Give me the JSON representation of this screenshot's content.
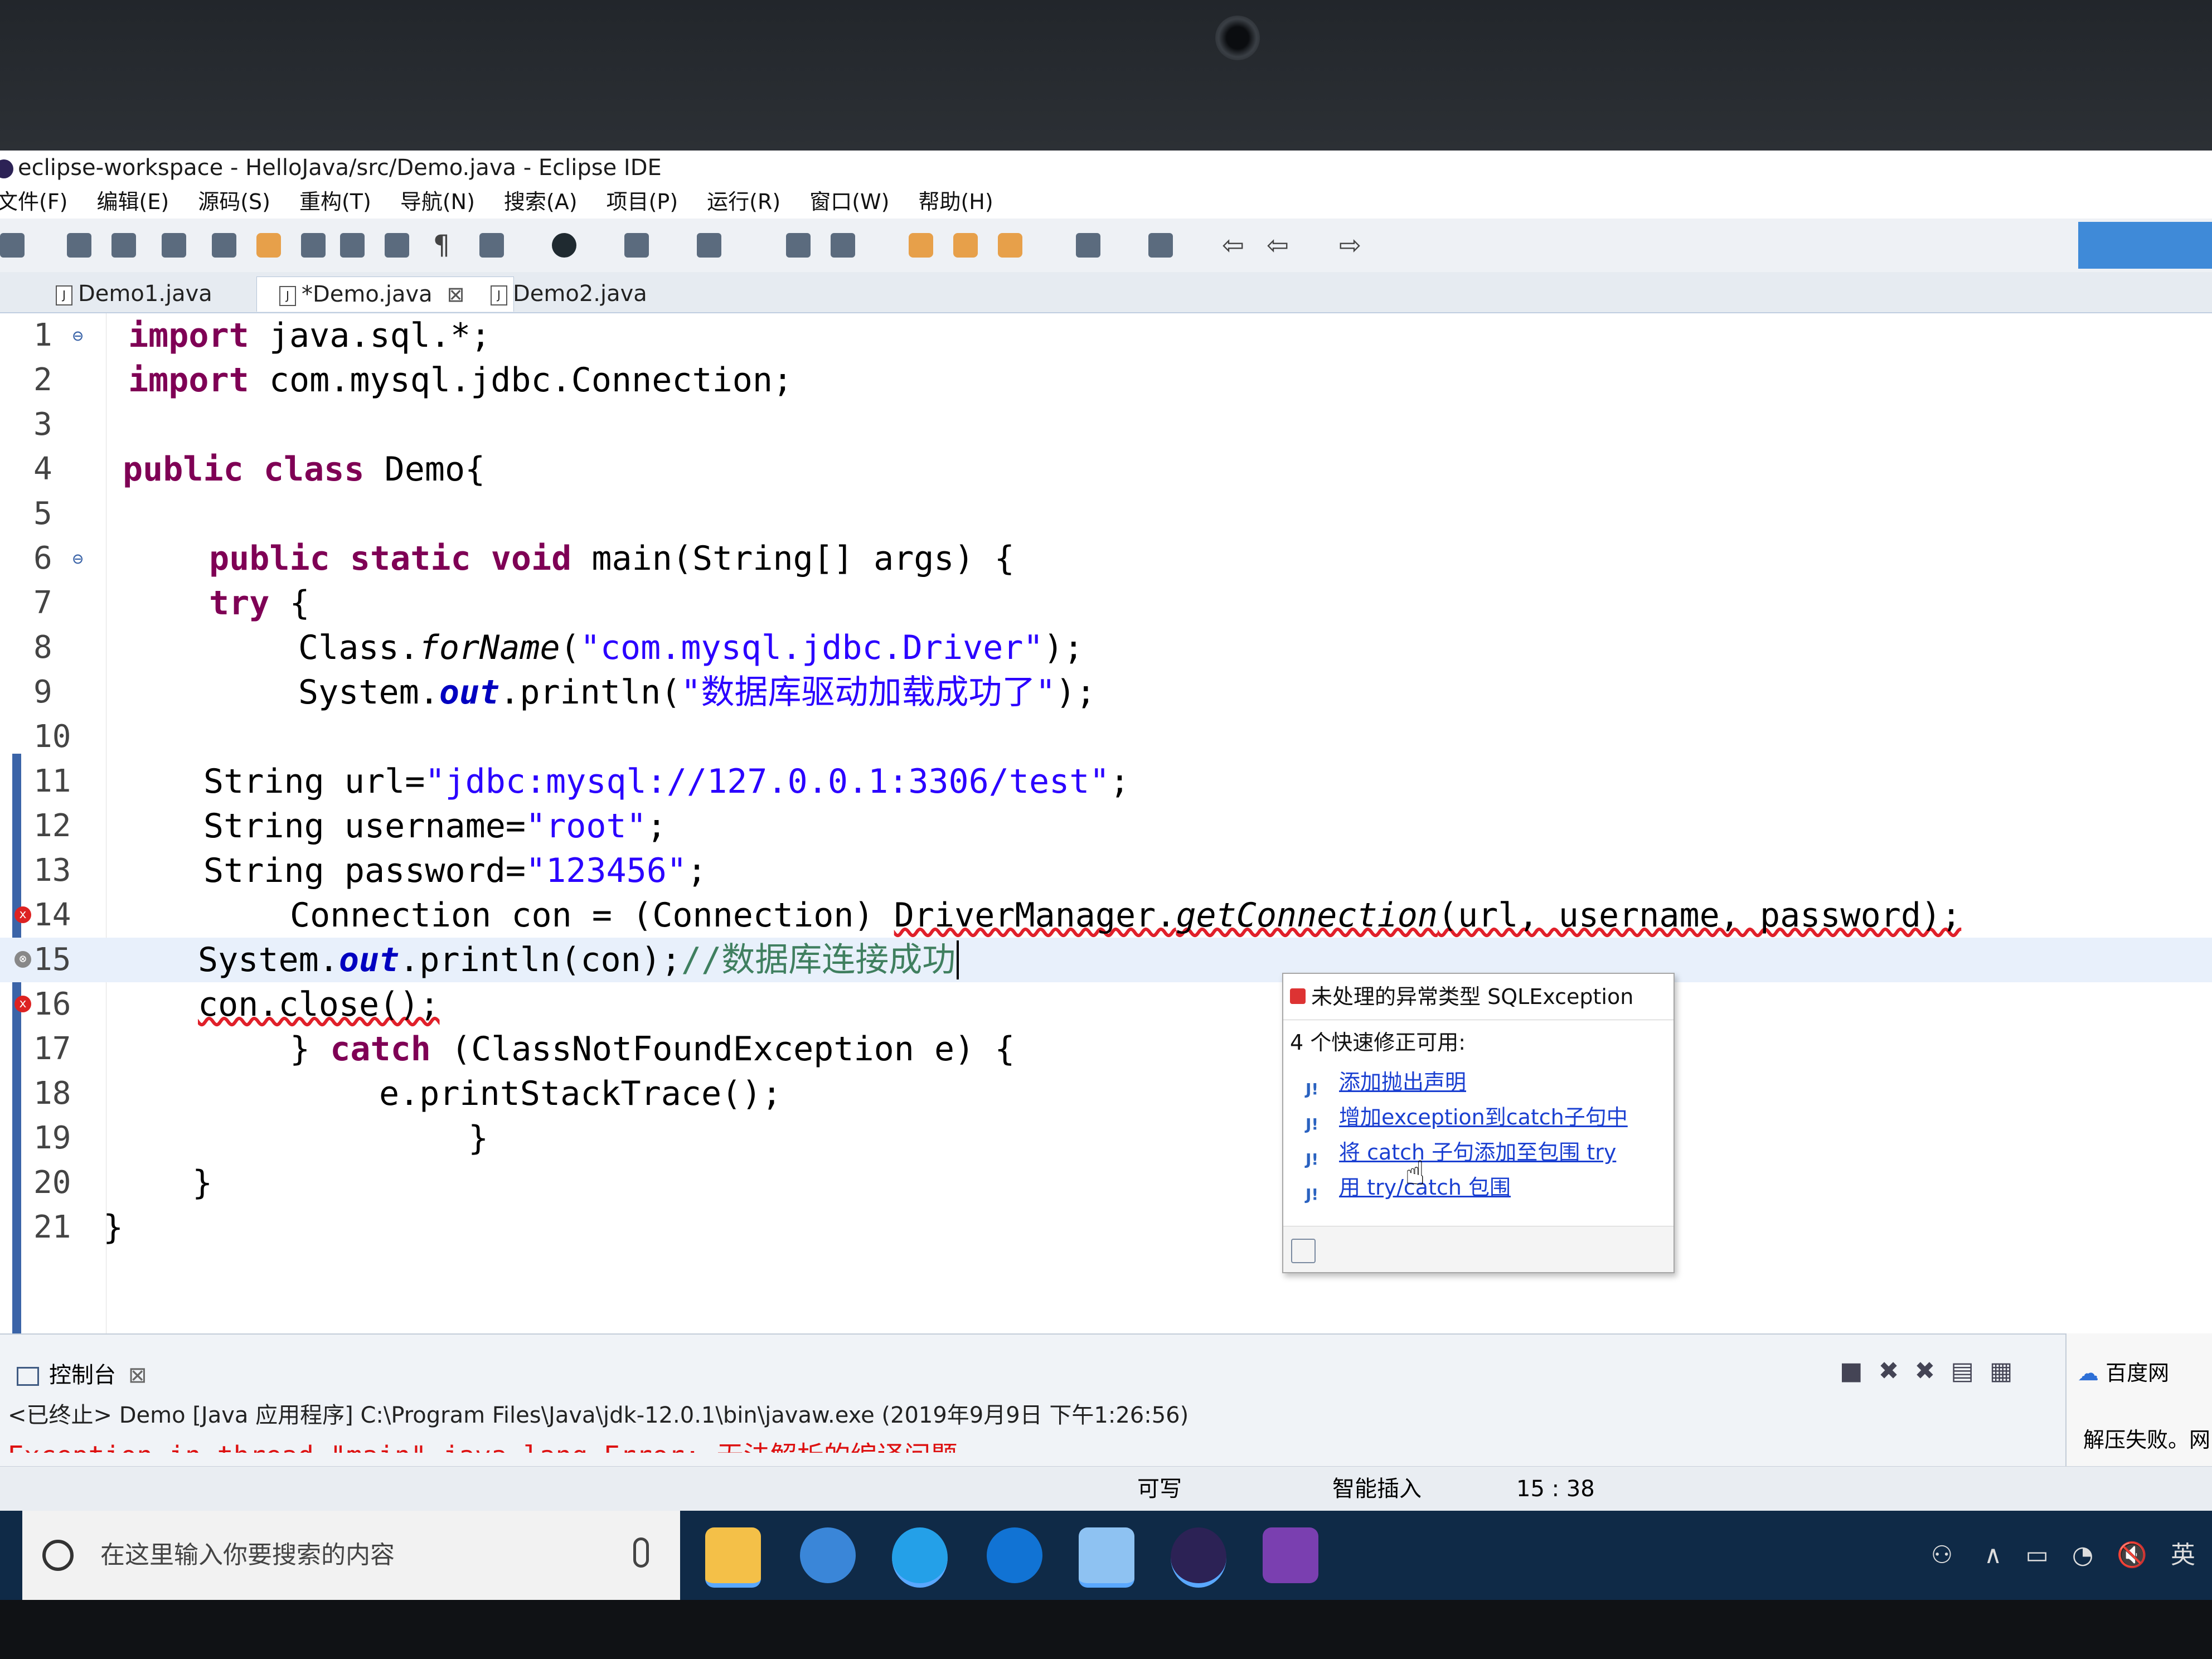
{
  "window": {
    "title": "eclipse-workspace - HelloJava/src/Demo.java - Eclipse IDE"
  },
  "menu": [
    "文件(F)",
    "编辑(E)",
    "源码(S)",
    "重构(T)",
    "导航(N)",
    "搜索(A)",
    "项目(P)",
    "运行(R)",
    "窗口(W)",
    "帮助(H)"
  ],
  "tabs": [
    {
      "label": "Demo1.java",
      "active": false
    },
    {
      "label": "*Demo.java",
      "active": true
    },
    {
      "label": "Demo2.java",
      "active": false
    }
  ],
  "editor": {
    "lines": [
      {
        "n": "1",
        "marker": "⊖"
      },
      {
        "n": "2"
      },
      {
        "n": "3"
      },
      {
        "n": "4"
      },
      {
        "n": "5"
      },
      {
        "n": "6",
        "marker": "⊖"
      },
      {
        "n": "7"
      },
      {
        "n": "8"
      },
      {
        "n": "9"
      },
      {
        "n": "10"
      },
      {
        "n": "11"
      },
      {
        "n": "12"
      },
      {
        "n": "13"
      },
      {
        "n": "14",
        "error": true
      },
      {
        "n": "15",
        "error": true
      },
      {
        "n": "16",
        "error": true
      },
      {
        "n": "17"
      },
      {
        "n": "18"
      },
      {
        "n": "19"
      },
      {
        "n": "20"
      },
      {
        "n": "21"
      }
    ],
    "code": {
      "l1_kw": "import",
      "l1_rest": " java.sql.*;",
      "l2_kw": "import",
      "l2_rest": " com.mysql.jdbc.Connection;",
      "l4_kw": "public class",
      "l4_rest": " Demo{",
      "l6_kw": "public static void",
      "l6_rest": " main(String[] args) {",
      "l7_kw": "try",
      "l7_rest": " {",
      "l8_a": "Class.",
      "l8_m": "forName",
      "l8_b": "(",
      "l8_s": "\"com.mysql.jdbc.Driver\"",
      "l8_c": ");",
      "l9_a": "System.",
      "l9_f": "out",
      "l9_b": ".println(",
      "l9_s": "\"数据库驱动加载成功了\"",
      "l9_c": ");",
      "l11_a": "String url=",
      "l11_s": "\"jdbc:mysql://127.0.0.1:3306/test\"",
      "l11_c": ";",
      "l12_a": "String username=",
      "l12_s": "\"root\"",
      "l12_c": ";",
      "l13_a": "String password=",
      "l13_s": "\"123456\"",
      "l13_c": ";",
      "l14_a": "Connection con = (Connection) ",
      "l14_e": "DriverManager.",
      "l14_m": "getConnection",
      "l14_c": "(url, username, password);",
      "l15_a": "System.",
      "l15_f": "out",
      "l15_b": ".println(con);",
      "l15_cm": "//数据库连接成功",
      "l16_e": "con.close();",
      "l17_a": "} ",
      "l17_kw": "catch",
      "l17_c": " (ClassNotFoundException e) {",
      "l18_a": "e.printStackTrace();",
      "l19_a": "}",
      "l20_a": "}",
      "l21_a": "}"
    }
  },
  "quickfix": {
    "header": "未处理的异常类型 SQLException",
    "subtitle": "4 个快速修正可用:",
    "fixes": [
      "添加抛出声明",
      "增加exception到catch子句中",
      "将 catch 子句添加至包围 try",
      "用 try/catch 包围"
    ]
  },
  "console": {
    "title": "控制台",
    "launch": "<已终止> Demo [Java 应用程序] C:\\Program Files\\Java\\jdk-12.0.1\\bin\\javaw.exe  (2019年9月9日 下午1:26:56)",
    "error_line": "Exception in thread \"main\" java.lang.Error: 无法解析的编译问题"
  },
  "side_panel": {
    "title": "百度网",
    "message": "解压失败。网"
  },
  "status": {
    "writable": "可写",
    "insert_mode": "智能插入",
    "position": "15 : 38"
  },
  "taskbar": {
    "search_placeholder": "在这里输入你要搜索的内容",
    "ime": "英"
  },
  "colors": {
    "keyword": "#7f0055",
    "string": "#2a00ff",
    "field": "#0000c0",
    "comment": "#3f7f5f",
    "link": "#1a3fd1",
    "error": "#e0202a"
  }
}
